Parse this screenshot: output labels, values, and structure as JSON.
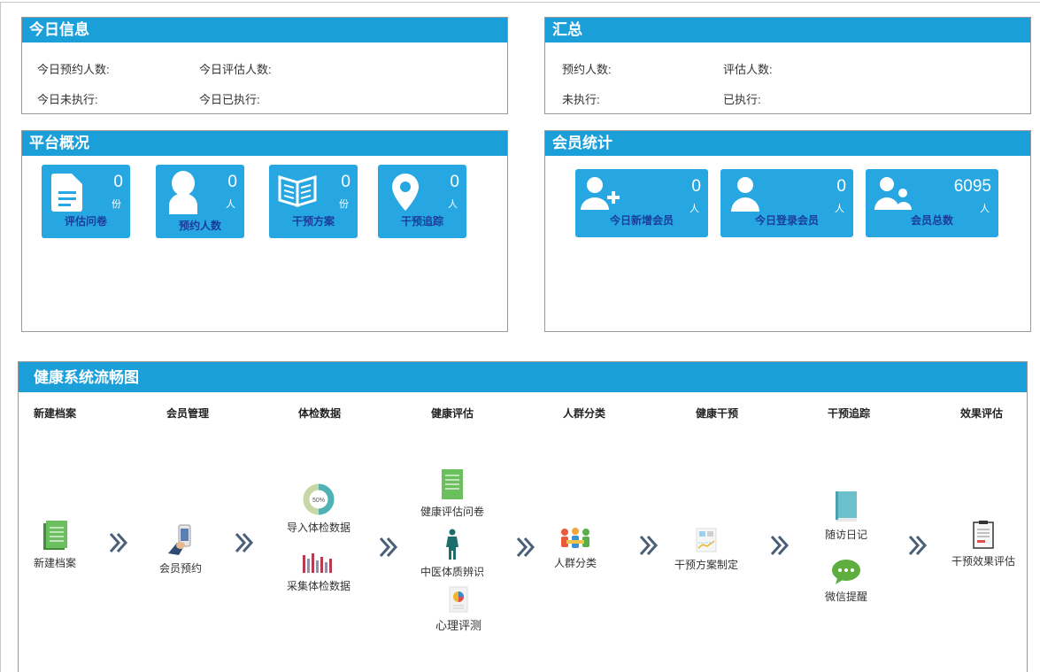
{
  "today": {
    "title": "今日信息",
    "booked": "今日预约人数:",
    "assessed": "今日评估人数:",
    "pending": "今日未执行:",
    "done": "今日已执行:"
  },
  "summary": {
    "title": "汇总",
    "booked": "预约人数:",
    "assessed": "评估人数:",
    "pending": "未执行:",
    "done": "已执行:"
  },
  "platform": {
    "title": "平台概况",
    "tiles": [
      {
        "value": "0",
        "unit": "份",
        "label": "评估问卷",
        "icon": "document-icon"
      },
      {
        "value": "0",
        "unit": "人",
        "label": "预约人数",
        "icon": "person-icon"
      },
      {
        "value": "0",
        "unit": "份",
        "label": "干预方案",
        "icon": "book-icon"
      },
      {
        "value": "0",
        "unit": "人",
        "label": "干预追踪",
        "icon": "map-pin-icon"
      }
    ]
  },
  "members": {
    "title": "会员统计",
    "tiles": [
      {
        "value": "0",
        "unit": "人",
        "label": "今日新增会员",
        "icon": "add-user-icon"
      },
      {
        "value": "0",
        "unit": "人",
        "label": "今日登录会员",
        "icon": "user-icon"
      },
      {
        "value": "6095",
        "unit": "人",
        "label": "会员总数",
        "icon": "users-icon"
      }
    ]
  },
  "flow": {
    "title": "健康系统流畅图",
    "steps": [
      "新建档案",
      "会员管理",
      "体检数据",
      "健康评估",
      "人群分类",
      "健康干预",
      "干预追踪",
      "效果评估"
    ],
    "items": {
      "new_file": "新建档案",
      "appointment": "会员预约",
      "import_exam": "导入体检数据",
      "collect_exam": "采集体检数据",
      "questionnaire": "健康评估问卷",
      "tcm": "中医体质辨识",
      "psych": "心理评测",
      "crowd": "人群分类",
      "plan": "干预方案制定",
      "diary": "随访日记",
      "wechat": "微信提醒",
      "effect": "干预效果评估",
      "donut_label": "50%"
    }
  }
}
